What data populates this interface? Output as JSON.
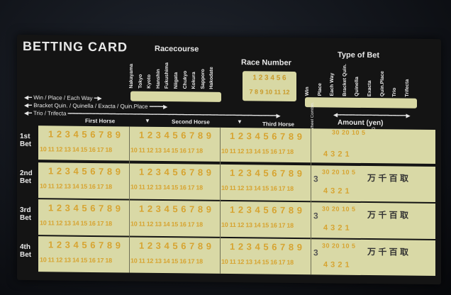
{
  "card": {
    "title": "BETTING CARD",
    "racecourse": {
      "heading": "Racecourse",
      "items": [
        "Nakayama",
        "Tokyo",
        "Kyoto",
        "Hanshin",
        "Fukushima",
        "Niigata",
        "Chukyo",
        "Kokura",
        "Sapporo",
        "Hakodate"
      ]
    },
    "race_number": {
      "heading": "Race Number",
      "row1": "1 2 3 4 5 6",
      "row2": "7 8 9 10 11 12"
    },
    "bet_type": {
      "heading": "Type of Bet",
      "items": [
        "Win",
        "Place",
        "Each Way",
        "Bracket Quin.",
        "Quinella",
        "Exacta",
        "Quin.Place",
        "Trio",
        "Trifecta"
      ]
    },
    "legend": {
      "line1": "Win / Place / Each Way",
      "line2": "Bracket Quin. / Quinella / Exacta / Quin.Place",
      "line3": "Trio / Trifecta"
    },
    "columns": {
      "first": "First Horse",
      "second": "Second Horse",
      "third": "Third Horse"
    },
    "amount": {
      "heading": "Amount (yen)",
      "units": [
        "×10,000",
        "×1,000",
        "×100",
        "Cancel"
      ],
      "row1": "30 20 10 5",
      "row2": "4 3 2 1"
    },
    "multi_label": "Multi/Wheel Combin.",
    "units_kanji": "万 千 百 取",
    "horse_row1": "1 2 3 4 5 6 7 8 9",
    "horse_row2": "10 11 12 13 14 15 16 17 18",
    "bets": [
      "1st Bet",
      "2nd Bet",
      "3rd Bet",
      "4th Bet"
    ]
  }
}
